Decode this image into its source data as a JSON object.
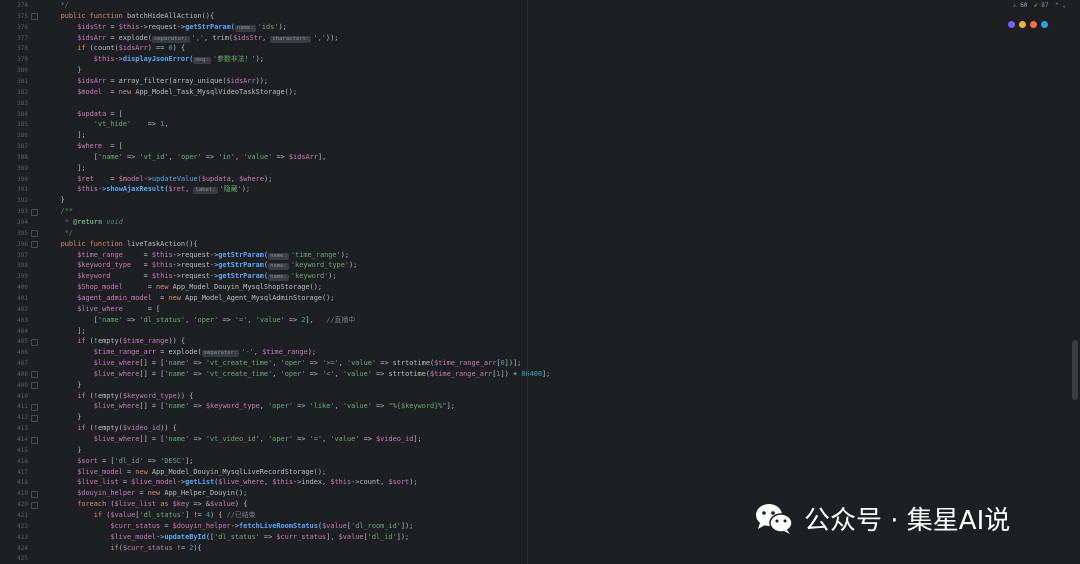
{
  "status": {
    "warnings": "⚠ 60",
    "checks": "✔ 87"
  },
  "browser_icons": [
    {
      "name": "phpstorm",
      "color": "#7c5cff"
    },
    {
      "name": "chrome",
      "color": "#e9b343"
    },
    {
      "name": "firefox",
      "color": "#ff6a3d"
    },
    {
      "name": "edge",
      "color": "#2da1e3"
    }
  ],
  "colors": {
    "background": "#1e1f22",
    "keyword": "#cf8e6d",
    "variable": "#c77dbb",
    "function": "#56a8f5",
    "string": "#6aab73",
    "number": "#2aacb8",
    "comment": "#7a7e85"
  },
  "watermark": "公众号 · 集星AI说",
  "line_numbers": [
    "374",
    "375",
    "376",
    "377",
    "378",
    "379",
    "380",
    "381",
    "382",
    "383",
    "384",
    "385",
    "386",
    "387",
    "388",
    "389",
    "390",
    "391",
    "392",
    "393",
    "394",
    "395",
    "396",
    "397",
    "398",
    "399",
    "400",
    "401",
    "402",
    "403",
    "404",
    "405",
    "406",
    "407",
    "408",
    "409",
    "410",
    "411",
    "412",
    "413",
    "414",
    "415",
    "416",
    "417",
    "418",
    "419",
    "420",
    "421",
    "422",
    "423",
    "424",
    "425"
  ],
  "code_lines": [
    [
      {
        "t": "    */",
        "c": "doc"
      }
    ],
    [
      {
        "t": "    public function ",
        "c": "kw"
      },
      {
        "t": "batchHideAllAction(){",
        "c": ""
      }
    ],
    [
      {
        "t": "        $idsStr",
        "c": "vr"
      },
      {
        "t": " = ",
        "c": ""
      },
      {
        "t": "$this",
        "c": "vr"
      },
      {
        "t": "->request->",
        "c": ""
      },
      {
        "t": "getStrParam(",
        "c": "fnb"
      },
      {
        "t": "name:",
        "c": "hint"
      },
      {
        "t": "'ids'",
        "c": "st"
      },
      {
        "t": ");",
        "c": ""
      }
    ],
    [
      {
        "t": "        $idsArr",
        "c": "vr"
      },
      {
        "t": " = explode(",
        "c": ""
      },
      {
        "t": "separator:",
        "c": "hint"
      },
      {
        "t": "','",
        "c": "st"
      },
      {
        "t": ", trim(",
        "c": ""
      },
      {
        "t": "$idsStr",
        "c": "vr"
      },
      {
        "t": ", ",
        "c": ""
      },
      {
        "t": "characters:",
        "c": "hint"
      },
      {
        "t": "','",
        "c": "st"
      },
      {
        "t": "));",
        "c": ""
      }
    ],
    [
      {
        "t": "        if ",
        "c": "kw"
      },
      {
        "t": "(count(",
        "c": ""
      },
      {
        "t": "$idsArr",
        "c": "vr"
      },
      {
        "t": ") == ",
        "c": ""
      },
      {
        "t": "0",
        "c": "nm"
      },
      {
        "t": ") {",
        "c": ""
      }
    ],
    [
      {
        "t": "            $this",
        "c": "vr"
      },
      {
        "t": "->",
        "c": ""
      },
      {
        "t": "displayJsonError(",
        "c": "fnb"
      },
      {
        "t": "msg:",
        "c": "hint"
      },
      {
        "t": "'参数非法！'",
        "c": "st"
      },
      {
        "t": ");",
        "c": ""
      }
    ],
    [
      {
        "t": "        }",
        "c": ""
      }
    ],
    [
      {
        "t": "        $idsArr",
        "c": "vr"
      },
      {
        "t": " = array_filter(array_unique(",
        "c": ""
      },
      {
        "t": "$idsArr",
        "c": "vr"
      },
      {
        "t": "));",
        "c": ""
      }
    ],
    [
      {
        "t": "        $model",
        "c": "vr"
      },
      {
        "t": "  = ",
        "c": ""
      },
      {
        "t": "new ",
        "c": "kw"
      },
      {
        "t": "App_Model_Task_MysqlVideoTaskStorage();",
        "c": ""
      }
    ],
    [
      {
        "t": "",
        "c": ""
      }
    ],
    [
      {
        "t": "        $updata",
        "c": "vr"
      },
      {
        "t": " = [",
        "c": ""
      }
    ],
    [
      {
        "t": "            'vt_hide'",
        "c": "st"
      },
      {
        "t": "    => ",
        "c": ""
      },
      {
        "t": "1",
        "c": "nm"
      },
      {
        "t": ",",
        "c": ""
      }
    ],
    [
      {
        "t": "        ];",
        "c": ""
      }
    ],
    [
      {
        "t": "        $where",
        "c": "vr"
      },
      {
        "t": "  = [",
        "c": ""
      }
    ],
    [
      {
        "t": "            [",
        "c": ""
      },
      {
        "t": "'name'",
        "c": "st"
      },
      {
        "t": " => ",
        "c": ""
      },
      {
        "t": "'vt_id'",
        "c": "st"
      },
      {
        "t": ", ",
        "c": ""
      },
      {
        "t": "'oper'",
        "c": "st"
      },
      {
        "t": " => ",
        "c": ""
      },
      {
        "t": "'in'",
        "c": "st"
      },
      {
        "t": ", ",
        "c": ""
      },
      {
        "t": "'value'",
        "c": "st"
      },
      {
        "t": " => ",
        "c": ""
      },
      {
        "t": "$idsArr",
        "c": "vr"
      },
      {
        "t": "],",
        "c": ""
      }
    ],
    [
      {
        "t": "        ];",
        "c": ""
      }
    ],
    [
      {
        "t": "        $ret",
        "c": "vr"
      },
      {
        "t": "    = ",
        "c": ""
      },
      {
        "t": "$model",
        "c": "vr"
      },
      {
        "t": "->",
        "c": ""
      },
      {
        "t": "updateValue(",
        "c": "fn"
      },
      {
        "t": "$updata",
        "c": "vr"
      },
      {
        "t": ", ",
        "c": ""
      },
      {
        "t": "$where",
        "c": "vr"
      },
      {
        "t": ");",
        "c": ""
      }
    ],
    [
      {
        "t": "        $this",
        "c": "vr"
      },
      {
        "t": "->",
        "c": ""
      },
      {
        "t": "showAjaxResult(",
        "c": "fnb"
      },
      {
        "t": "$ret",
        "c": "vr"
      },
      {
        "t": ", ",
        "c": ""
      },
      {
        "t": "label:",
        "c": "hint"
      },
      {
        "t": "'隐藏'",
        "c": "st"
      },
      {
        "t": ");",
        "c": ""
      }
    ],
    [
      {
        "t": "    }",
        "c": ""
      }
    ],
    [
      {
        "t": "    /**",
        "c": "doc"
      }
    ],
    [
      {
        "t": "     * ",
        "c": "doc"
      },
      {
        "t": "@return",
        "c": "tag"
      },
      {
        "t": " void",
        "c": "doc"
      }
    ],
    [
      {
        "t": "     */",
        "c": "doc"
      }
    ],
    [
      {
        "t": "    public function ",
        "c": "kw"
      },
      {
        "t": "liveTaskAction(){",
        "c": ""
      }
    ],
    [
      {
        "t": "        $time_range",
        "c": "vr"
      },
      {
        "t": "     = ",
        "c": ""
      },
      {
        "t": "$this",
        "c": "vr"
      },
      {
        "t": "->request->",
        "c": ""
      },
      {
        "t": "getStrParam(",
        "c": "fnb"
      },
      {
        "t": "name:",
        "c": "hint"
      },
      {
        "t": "'time_range'",
        "c": "st"
      },
      {
        "t": ");",
        "c": ""
      }
    ],
    [
      {
        "t": "        $keyword_type",
        "c": "vr"
      },
      {
        "t": "   = ",
        "c": ""
      },
      {
        "t": "$this",
        "c": "vr"
      },
      {
        "t": "->request->",
        "c": ""
      },
      {
        "t": "getStrParam(",
        "c": "fnb"
      },
      {
        "t": "name:",
        "c": "hint"
      },
      {
        "t": "'keyword_type'",
        "c": "st"
      },
      {
        "t": ");",
        "c": ""
      }
    ],
    [
      {
        "t": "        $keyword",
        "c": "vr"
      },
      {
        "t": "        = ",
        "c": ""
      },
      {
        "t": "$this",
        "c": "vr"
      },
      {
        "t": "->request->",
        "c": ""
      },
      {
        "t": "getStrParam(",
        "c": "fnb"
      },
      {
        "t": "name:",
        "c": "hint"
      },
      {
        "t": "'keyword'",
        "c": "st"
      },
      {
        "t": ");",
        "c": ""
      }
    ],
    [
      {
        "t": "        $Shop_model",
        "c": "vr"
      },
      {
        "t": "      = ",
        "c": ""
      },
      {
        "t": "new ",
        "c": "kw"
      },
      {
        "t": "App_Model_Douyin_MysqlShopStorage();",
        "c": ""
      }
    ],
    [
      {
        "t": "        $agent_admin_model",
        "c": "vr"
      },
      {
        "t": "  = ",
        "c": ""
      },
      {
        "t": "new ",
        "c": "kw"
      },
      {
        "t": "App_Model_Agent_MysqlAdminStorage();",
        "c": ""
      }
    ],
    [
      {
        "t": "        $live_where",
        "c": "vr"
      },
      {
        "t": "      = [",
        "c": ""
      }
    ],
    [
      {
        "t": "            [",
        "c": ""
      },
      {
        "t": "'name'",
        "c": "st"
      },
      {
        "t": " => ",
        "c": ""
      },
      {
        "t": "'dl_status'",
        "c": "st"
      },
      {
        "t": ", ",
        "c": ""
      },
      {
        "t": "'oper'",
        "c": "st"
      },
      {
        "t": " => ",
        "c": ""
      },
      {
        "t": "'='",
        "c": "st"
      },
      {
        "t": ", ",
        "c": ""
      },
      {
        "t": "'value'",
        "c": "st"
      },
      {
        "t": " => ",
        "c": ""
      },
      {
        "t": "2",
        "c": "nm"
      },
      {
        "t": "],   ",
        "c": ""
      },
      {
        "t": "//直播中",
        "c": "cm"
      }
    ],
    [
      {
        "t": "        ];",
        "c": ""
      }
    ],
    [
      {
        "t": "        if ",
        "c": "kw"
      },
      {
        "t": "(!empty(",
        "c": ""
      },
      {
        "t": "$time_range",
        "c": "vr"
      },
      {
        "t": ")) {",
        "c": ""
      }
    ],
    [
      {
        "t": "            $time_range_arr",
        "c": "vr"
      },
      {
        "t": " = explode(",
        "c": ""
      },
      {
        "t": "separator:",
        "c": "hint"
      },
      {
        "t": "'-'",
        "c": "st"
      },
      {
        "t": ", ",
        "c": ""
      },
      {
        "t": "$time_range",
        "c": "vr"
      },
      {
        "t": ");",
        "c": ""
      }
    ],
    [
      {
        "t": "            $live_where",
        "c": "vr"
      },
      {
        "t": "[] = [",
        "c": ""
      },
      {
        "t": "'name'",
        "c": "st"
      },
      {
        "t": " => ",
        "c": ""
      },
      {
        "t": "'vt_create_time'",
        "c": "st"
      },
      {
        "t": ", ",
        "c": ""
      },
      {
        "t": "'oper'",
        "c": "st"
      },
      {
        "t": " => ",
        "c": ""
      },
      {
        "t": "'>='",
        "c": "st"
      },
      {
        "t": ", ",
        "c": ""
      },
      {
        "t": "'value'",
        "c": "st"
      },
      {
        "t": " => strtotime(",
        "c": ""
      },
      {
        "t": "$time_range_arr",
        "c": "vr"
      },
      {
        "t": "[",
        "c": ""
      },
      {
        "t": "0",
        "c": "nm"
      },
      {
        "t": "])];",
        "c": ""
      }
    ],
    [
      {
        "t": "            $live_where",
        "c": "vr"
      },
      {
        "t": "[] = [",
        "c": ""
      },
      {
        "t": "'name'",
        "c": "st"
      },
      {
        "t": " => ",
        "c": ""
      },
      {
        "t": "'vt_create_time'",
        "c": "st"
      },
      {
        "t": ", ",
        "c": ""
      },
      {
        "t": "'oper'",
        "c": "st"
      },
      {
        "t": " => ",
        "c": ""
      },
      {
        "t": "'<'",
        "c": "st"
      },
      {
        "t": ", ",
        "c": ""
      },
      {
        "t": "'value'",
        "c": "st"
      },
      {
        "t": " => strtotime(",
        "c": ""
      },
      {
        "t": "$time_range_arr",
        "c": "vr"
      },
      {
        "t": "[",
        "c": ""
      },
      {
        "t": "1",
        "c": "nm"
      },
      {
        "t": "]) + ",
        "c": ""
      },
      {
        "t": "86400",
        "c": "nm"
      },
      {
        "t": "];",
        "c": ""
      }
    ],
    [
      {
        "t": "        }",
        "c": ""
      }
    ],
    [
      {
        "t": "        if ",
        "c": "kw"
      },
      {
        "t": "(!empty(",
        "c": ""
      },
      {
        "t": "$keyword_type",
        "c": "vr"
      },
      {
        "t": ")) {",
        "c": ""
      }
    ],
    [
      {
        "t": "            $live_where",
        "c": "vr"
      },
      {
        "t": "[] = [",
        "c": ""
      },
      {
        "t": "'name'",
        "c": "st"
      },
      {
        "t": " => ",
        "c": ""
      },
      {
        "t": "$keyword_type",
        "c": "vr"
      },
      {
        "t": ", ",
        "c": ""
      },
      {
        "t": "'oper'",
        "c": "st"
      },
      {
        "t": " => ",
        "c": ""
      },
      {
        "t": "'like'",
        "c": "st"
      },
      {
        "t": ", ",
        "c": ""
      },
      {
        "t": "'value'",
        "c": "st"
      },
      {
        "t": " => ",
        "c": ""
      },
      {
        "t": "\"%{$keyword}%\"",
        "c": "st"
      },
      {
        "t": "];",
        "c": ""
      }
    ],
    [
      {
        "t": "        }",
        "c": ""
      }
    ],
    [
      {
        "t": "        if ",
        "c": "kw"
      },
      {
        "t": "(!empty(",
        "c": ""
      },
      {
        "t": "$video_id",
        "c": "vr"
      },
      {
        "t": ")) {",
        "c": ""
      }
    ],
    [
      {
        "t": "            $live_where",
        "c": "vr"
      },
      {
        "t": "[] = [",
        "c": ""
      },
      {
        "t": "'name'",
        "c": "st"
      },
      {
        "t": " => ",
        "c": ""
      },
      {
        "t": "'vt_video_id'",
        "c": "st"
      },
      {
        "t": ", ",
        "c": ""
      },
      {
        "t": "'oper'",
        "c": "st"
      },
      {
        "t": " => ",
        "c": ""
      },
      {
        "t": "'='",
        "c": "st"
      },
      {
        "t": ", ",
        "c": ""
      },
      {
        "t": "'value'",
        "c": "st"
      },
      {
        "t": " => ",
        "c": ""
      },
      {
        "t": "$video_id",
        "c": "vr"
      },
      {
        "t": "];",
        "c": ""
      }
    ],
    [
      {
        "t": "        }",
        "c": ""
      }
    ],
    [
      {
        "t": "        $sort",
        "c": "vr"
      },
      {
        "t": " = [",
        "c": ""
      },
      {
        "t": "'dl_id'",
        "c": "st"
      },
      {
        "t": " => ",
        "c": ""
      },
      {
        "t": "'DESC'",
        "c": "st"
      },
      {
        "t": "];",
        "c": ""
      }
    ],
    [
      {
        "t": "        $live_model",
        "c": "vr"
      },
      {
        "t": " = ",
        "c": ""
      },
      {
        "t": "new ",
        "c": "kw"
      },
      {
        "t": "App_Model_Douyin_MysqlLiveRecordStorage();",
        "c": ""
      }
    ],
    [
      {
        "t": "        $live_list",
        "c": "vr"
      },
      {
        "t": " = ",
        "c": ""
      },
      {
        "t": "$live_model",
        "c": "vr"
      },
      {
        "t": "->",
        "c": ""
      },
      {
        "t": "getList(",
        "c": "fnb"
      },
      {
        "t": "$live_where",
        "c": "vr"
      },
      {
        "t": ", ",
        "c": ""
      },
      {
        "t": "$this",
        "c": "vr"
      },
      {
        "t": "->index, ",
        "c": ""
      },
      {
        "t": "$this",
        "c": "vr"
      },
      {
        "t": "->count, ",
        "c": ""
      },
      {
        "t": "$sort",
        "c": "vr"
      },
      {
        "t": ");",
        "c": ""
      }
    ],
    [
      {
        "t": "        $douyin_helper",
        "c": "vr"
      },
      {
        "t": " = ",
        "c": ""
      },
      {
        "t": "new ",
        "c": "kw"
      },
      {
        "t": "App_Helper_Douyin();",
        "c": ""
      }
    ],
    [
      {
        "t": "        foreach ",
        "c": "kw"
      },
      {
        "t": "(",
        "c": ""
      },
      {
        "t": "$live_list",
        "c": "vr"
      },
      {
        "t": " as ",
        "c": "kw"
      },
      {
        "t": "$key",
        "c": "vr"
      },
      {
        "t": " => &",
        "c": ""
      },
      {
        "t": "$value",
        "c": "vr"
      },
      {
        "t": ") {",
        "c": ""
      }
    ],
    [
      {
        "t": "            if ",
        "c": "kw"
      },
      {
        "t": "(",
        "c": ""
      },
      {
        "t": "$value",
        "c": "vr"
      },
      {
        "t": "[",
        "c": ""
      },
      {
        "t": "'dl_status'",
        "c": "st"
      },
      {
        "t": "] != ",
        "c": ""
      },
      {
        "t": "4",
        "c": "nm"
      },
      {
        "t": ") { ",
        "c": ""
      },
      {
        "t": "//已结束",
        "c": "cm"
      }
    ],
    [
      {
        "t": "                $curr_status",
        "c": "vr"
      },
      {
        "t": " = ",
        "c": ""
      },
      {
        "t": "$douyin_helper",
        "c": "vr"
      },
      {
        "t": "->",
        "c": ""
      },
      {
        "t": "fetchLiveRoomStatus(",
        "c": "fnb"
      },
      {
        "t": "$value",
        "c": "vr"
      },
      {
        "t": "[",
        "c": ""
      },
      {
        "t": "'dl_room_id'",
        "c": "st"
      },
      {
        "t": "]);",
        "c": ""
      }
    ],
    [
      {
        "t": "                $live_model",
        "c": "vr"
      },
      {
        "t": "->",
        "c": ""
      },
      {
        "t": "updateById(",
        "c": "fnb"
      },
      {
        "t": "[",
        "c": ""
      },
      {
        "t": "'dl_status'",
        "c": "st"
      },
      {
        "t": " => ",
        "c": ""
      },
      {
        "t": "$curr_status",
        "c": "vr"
      },
      {
        "t": "], ",
        "c": ""
      },
      {
        "t": "$value",
        "c": "vr"
      },
      {
        "t": "[",
        "c": ""
      },
      {
        "t": "'dl_id'",
        "c": "st"
      },
      {
        "t": "]);",
        "c": ""
      }
    ],
    [
      {
        "t": "                if",
        "c": "kw"
      },
      {
        "t": "(",
        "c": ""
      },
      {
        "t": "$curr_status",
        "c": "vr"
      },
      {
        "t": " != ",
        "c": ""
      },
      {
        "t": "2",
        "c": "nm"
      },
      {
        "t": "){",
        "c": ""
      }
    ]
  ]
}
